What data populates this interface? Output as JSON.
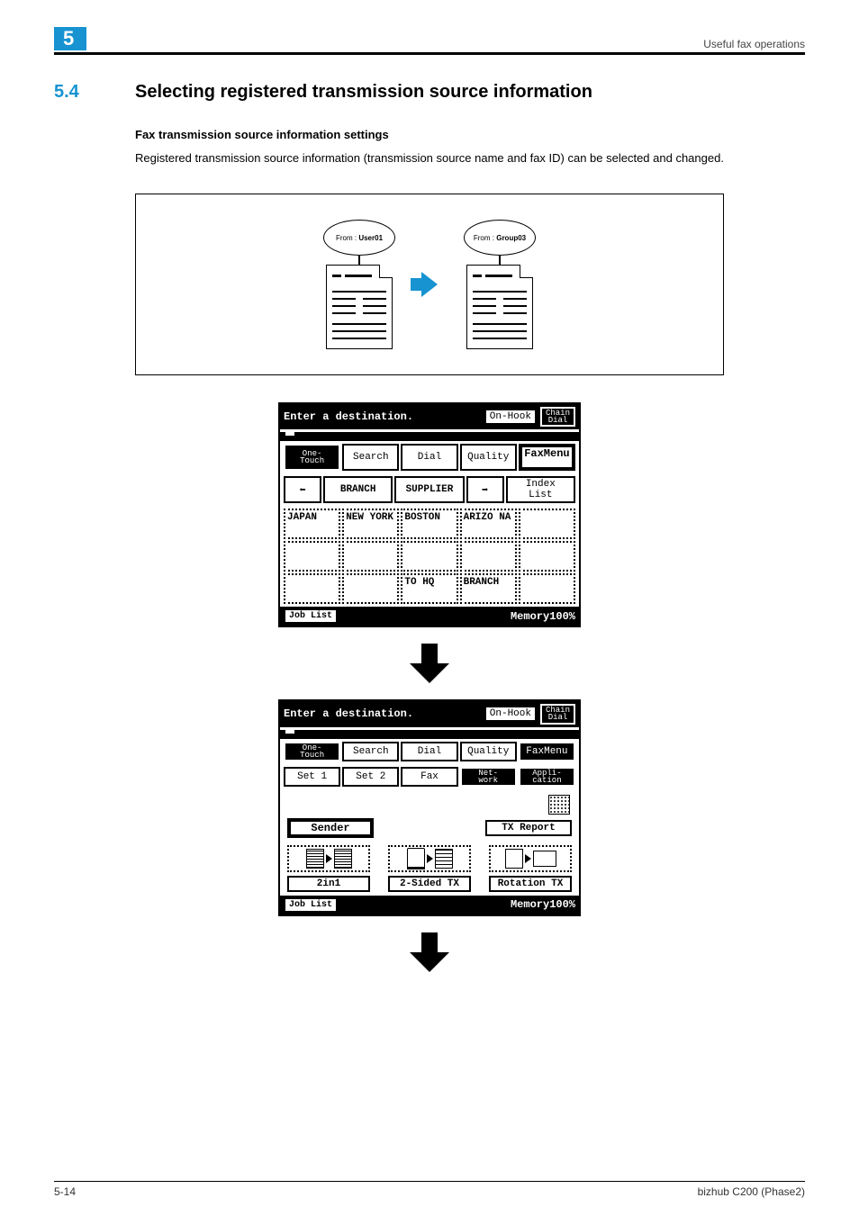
{
  "header": {
    "chapter": "5",
    "breadcrumb": "Useful fax operations"
  },
  "section": {
    "number": "5.4",
    "title": "Selecting registered transmission source information"
  },
  "subheading": "Fax transmission source information settings",
  "body": "Registered transmission source information (transmission source name and fax ID) can be selected and changed.",
  "illustration": {
    "bubble_left": "From : User01",
    "bubble_right": "From : Group03"
  },
  "lcd1": {
    "bar_msg": "Enter a destination.",
    "on_hook": "On-Hook",
    "chain_dial": "Chain\nDial",
    "tabs": {
      "one_touch": "One-\nTouch",
      "search": "Search",
      "dial": "Dial",
      "quality": "Quality",
      "faxmenu": "FaxMenu"
    },
    "nav": {
      "branch": "BRANCH",
      "supplier": "SUPPLIER",
      "index_list": "Index List"
    },
    "grid": [
      "JAPAN",
      "NEW YORK",
      "BOSTON",
      "ARIZO NA",
      "",
      "",
      "",
      "",
      "",
      "",
      "",
      "",
      "TO HQ",
      "BRANCH",
      ""
    ],
    "job_list": "Job List",
    "memory": "Memory100%"
  },
  "lcd2": {
    "bar_msg": "Enter a destination.",
    "on_hook": "On-Hook",
    "chain_dial": "Chain\nDial",
    "tabs": {
      "one_touch": "One-\nTouch",
      "search": "Search",
      "dial": "Dial",
      "quality": "Quality",
      "faxmenu": "FaxMenu"
    },
    "row2": {
      "set1": "Set 1",
      "set2": "Set 2",
      "fax": "Fax",
      "network": "Net-\nwork",
      "application": "Appli-\ncation"
    },
    "sender": "Sender",
    "tx_report": "TX Report",
    "two_in_one": "2in1",
    "two_sided": "2-Sided TX",
    "rotation": "Rotation TX",
    "job_list": "Job List",
    "memory": "Memory100%"
  },
  "footer": {
    "page": "5-14",
    "product": "bizhub C200 (Phase2)"
  }
}
